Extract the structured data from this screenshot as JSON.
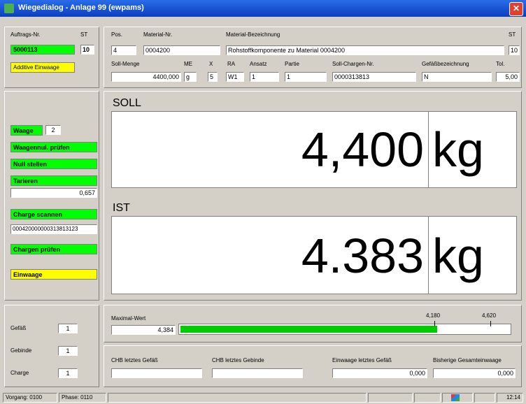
{
  "window": {
    "title": "Wiegedialog - Anlage 99  (ewpams)",
    "close_glyph": "✕"
  },
  "order": {
    "auftrag_label": "Auftrags-Nr.",
    "auftrag_value": "5000113",
    "st_label": "ST",
    "st_value": "10",
    "additive": "Additive Einwaage"
  },
  "material": {
    "pos_label": "Pos.",
    "pos_value": "4",
    "matnr_label": "Material-Nr.",
    "matnr_value": "0004200",
    "bez_label": "Material-Bezeichnung",
    "bez_value": "Rohstoffkomponente zu Material 0004200",
    "st_label": "ST",
    "st_value": "10",
    "soll_label": "Soll-Menge",
    "soll_value": "4400,000",
    "me_label": "ME",
    "me_value": "g",
    "x_label": "X",
    "x_value": "5",
    "ra_label": "RA",
    "ra_value": "W1",
    "ansatz_label": "Ansatz",
    "ansatz_value": "1",
    "partie_label": "Partie",
    "partie_value": "1",
    "charge_label": "Soll-Chargen-Nr.",
    "charge_value": "0000313813",
    "gefaess_label": "Gefäßbezeichnung",
    "gefaess_value": "N",
    "tol_label": "Tol.",
    "tol_value": "5,00"
  },
  "steps": {
    "waage_label": "Waage",
    "waage_value": "2",
    "waagennull": "Waagennul. prüfen",
    "null": "Null stellen",
    "tarieren": "Tarieren",
    "tara_value": "0,657",
    "charge_scan": "Charge scannen",
    "charge_scan_value": "000420000000313813123",
    "chargen_pruefen": "Chargen prüfen",
    "einwaage": "Einwaage"
  },
  "soll": {
    "label": "SOLL",
    "value": "4,400",
    "unit": "kg"
  },
  "ist": {
    "label": "IST",
    "value": "4.383",
    "unit": "kg"
  },
  "progress": {
    "label": "Maximal-Wert",
    "value_text": "4,384",
    "tick1": "4,180",
    "tick2": "4,620",
    "fill_fraction": 0.78
  },
  "counts": {
    "gefaess_label": "Gefäß",
    "gefaess_value": "1",
    "gebinde_label": "Gebinde",
    "gebinde_value": "1",
    "charge_label": "Charge",
    "charge_value": "1"
  },
  "bottom": {
    "chb_gefaess_label": "CHB letztes Gefäß",
    "chb_gefaess_value": "",
    "chb_gebinde_label": "CHB letztes Gebinde",
    "chb_gebinde_value": "",
    "einwaage_label": "Einwaage letztes Gefäß",
    "einwaage_value": "0,000",
    "gesamt_label": "Bisherige Gesamteinwaage",
    "gesamt_value": "0,000"
  },
  "status": {
    "vorgang": "Vorgang: 0100",
    "phase": "Phase: 0110",
    "time": "12:14"
  },
  "colors": {
    "green": "#00ff00",
    "yellow": "#ffff00",
    "progress": "#00cc00"
  }
}
